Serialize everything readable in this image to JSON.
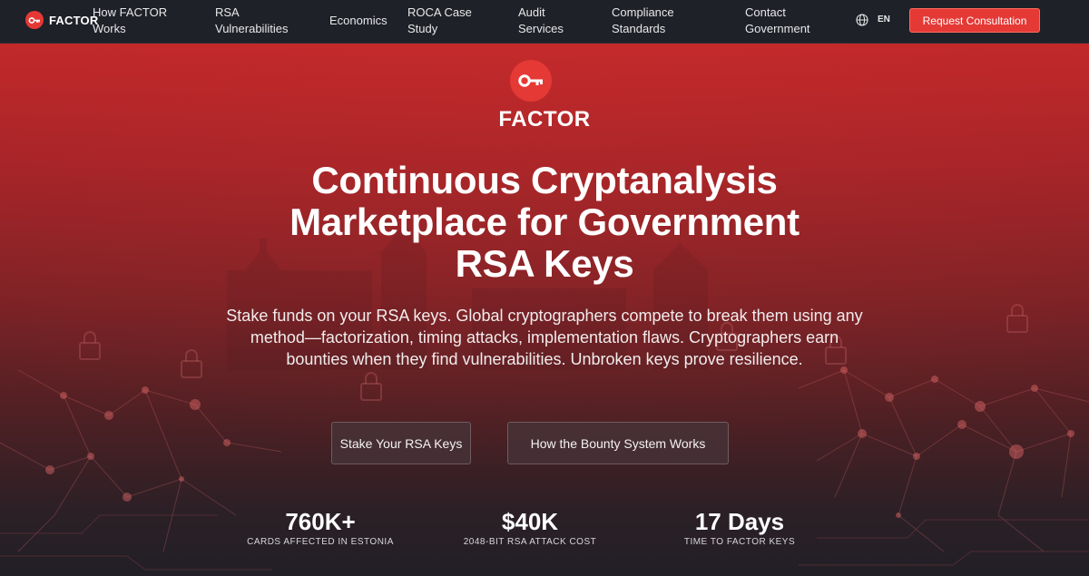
{
  "nav": {
    "brand": "FACTOR",
    "items": [
      {
        "line1": "How FACTOR",
        "line2": "Works"
      },
      {
        "line1": "RSA",
        "line2": "Vulnerabilities"
      },
      {
        "line1": "Economics",
        "line2": ""
      },
      {
        "line1": "ROCA Case",
        "line2": "Study"
      },
      {
        "line1": "Audit",
        "line2": "Services"
      },
      {
        "line1": "Compliance",
        "line2": "Standards"
      },
      {
        "line1": "Contact",
        "line2": "Government"
      }
    ],
    "lang": "EN",
    "cta": "Request Consultation"
  },
  "hero": {
    "brand": "FACTOR",
    "headline_lines": [
      "Continuous Cryptanalysis",
      "Marketplace for Government",
      "RSA Keys"
    ],
    "subtitle": "Stake funds on your RSA keys. Global cryptographers compete to break them using any method—factorization, timing attacks, implementation flaws. Cryptographers earn bounties when they find vulnerabilities. Unbroken keys prove resilience.",
    "buttons": [
      "Stake Your RSA Keys",
      "How the Bounty System Works"
    ],
    "stats": [
      {
        "value": "760K+",
        "label": "CARDS AFFECTED IN ESTONIA"
      },
      {
        "value": "$40K",
        "label": "2048-BIT RSA ATTACK COST"
      },
      {
        "value": "17 Days",
        "label": "TIME TO FACTOR KEYS"
      }
    ]
  },
  "colors": {
    "accent": "#e53935",
    "nav_bg": "#1f2128"
  },
  "icons": {
    "logo": "key-icon",
    "language": "globe-icon"
  }
}
